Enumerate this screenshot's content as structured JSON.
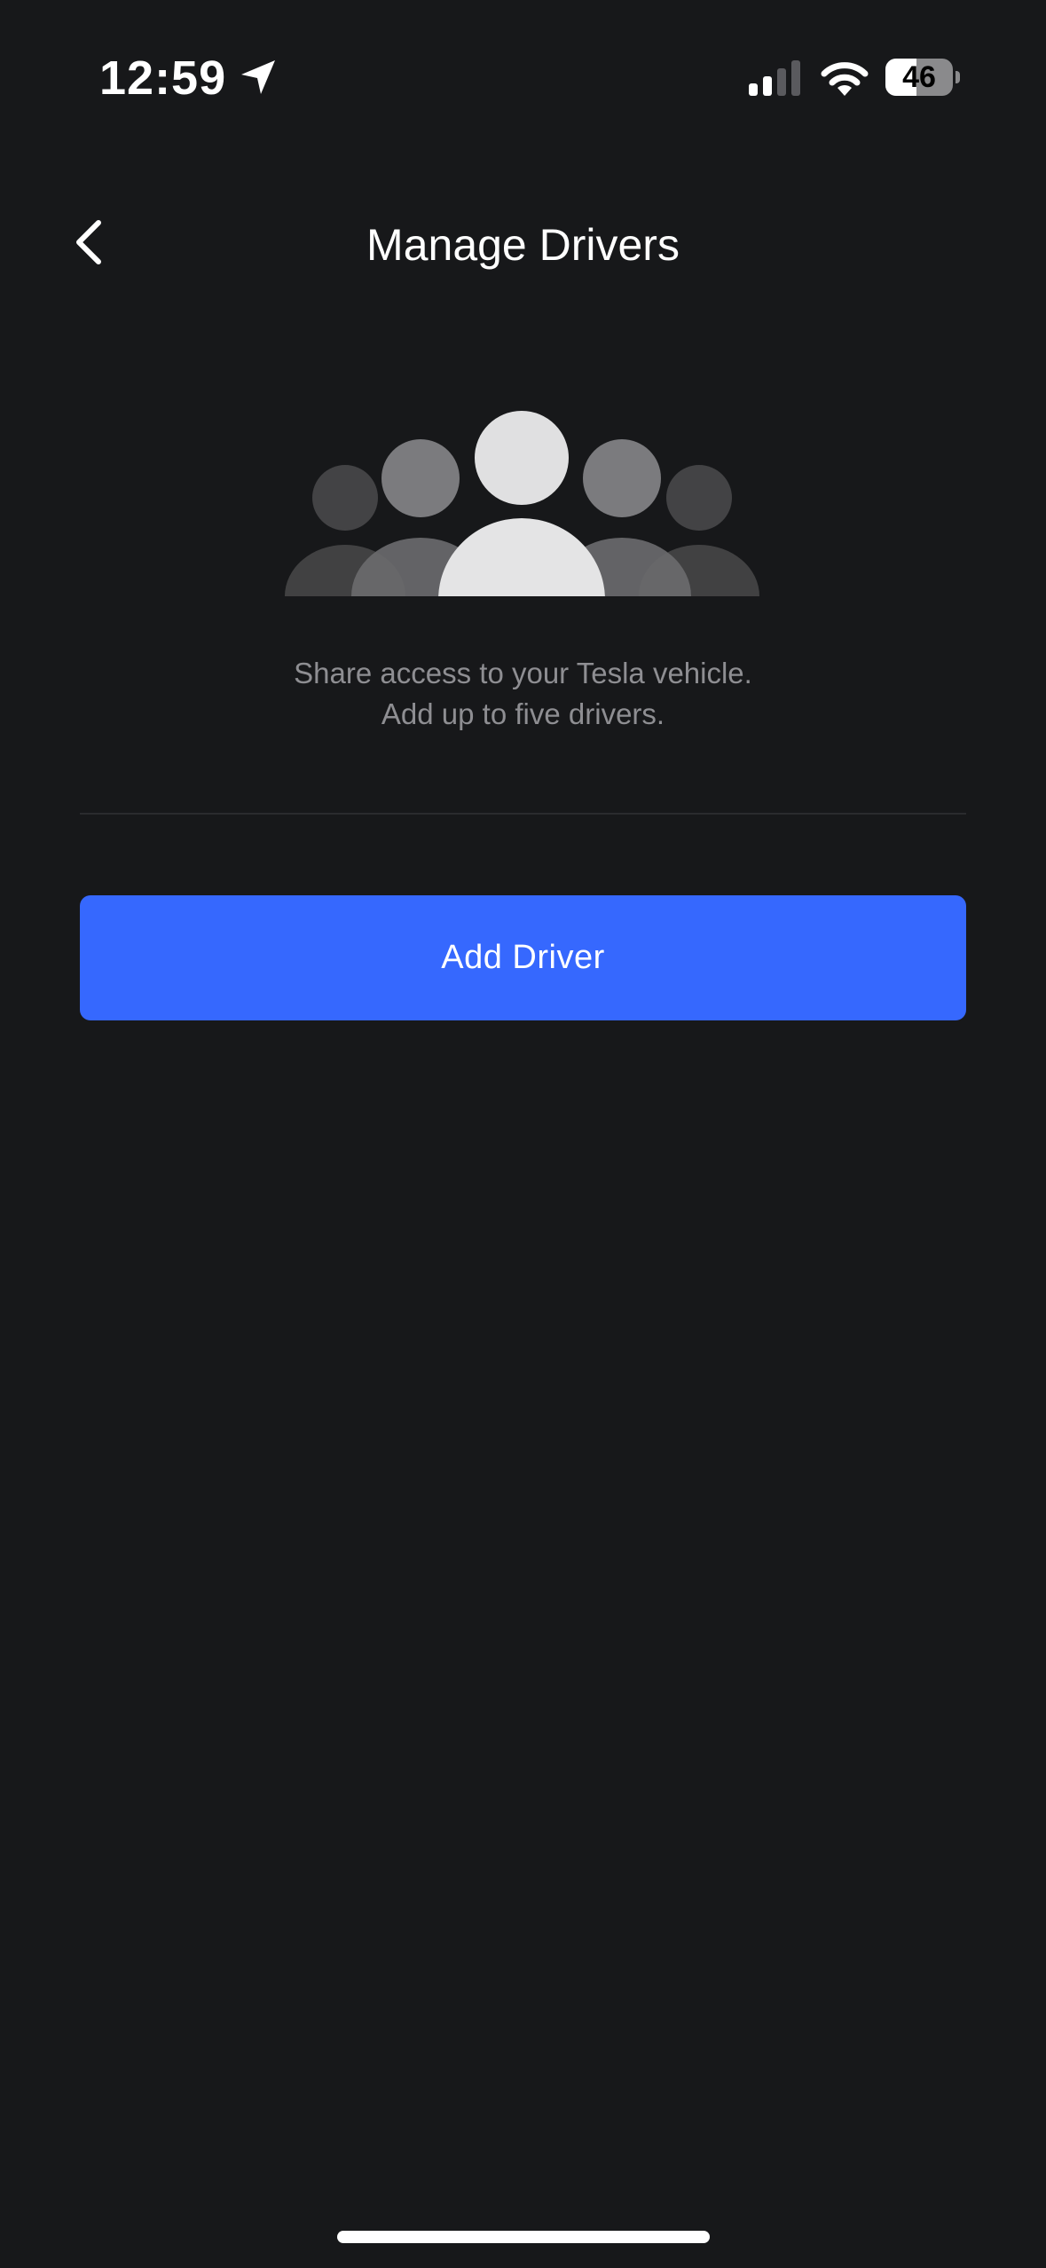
{
  "status_bar": {
    "time": "12:59",
    "battery_percent": 46,
    "battery_label": "46",
    "signal_bars_active": 2,
    "signal_bars_total": 4,
    "icons": [
      "location-arrow-icon",
      "cellular-signal-icon",
      "wifi-icon",
      "battery-icon"
    ]
  },
  "header": {
    "title": "Manage Drivers",
    "back_icon": "chevron-left-icon"
  },
  "illustration": {
    "icon": "drivers-group-icon"
  },
  "description": {
    "line1": "Share access to your Tesla vehicle.",
    "line2": "Add up to five drivers."
  },
  "actions": {
    "add_driver_label": "Add Driver"
  },
  "colors": {
    "background": "#17181a",
    "accent": "#3668fe",
    "secondary_text": "#8e8e92",
    "divider": "#2a2b2e"
  }
}
